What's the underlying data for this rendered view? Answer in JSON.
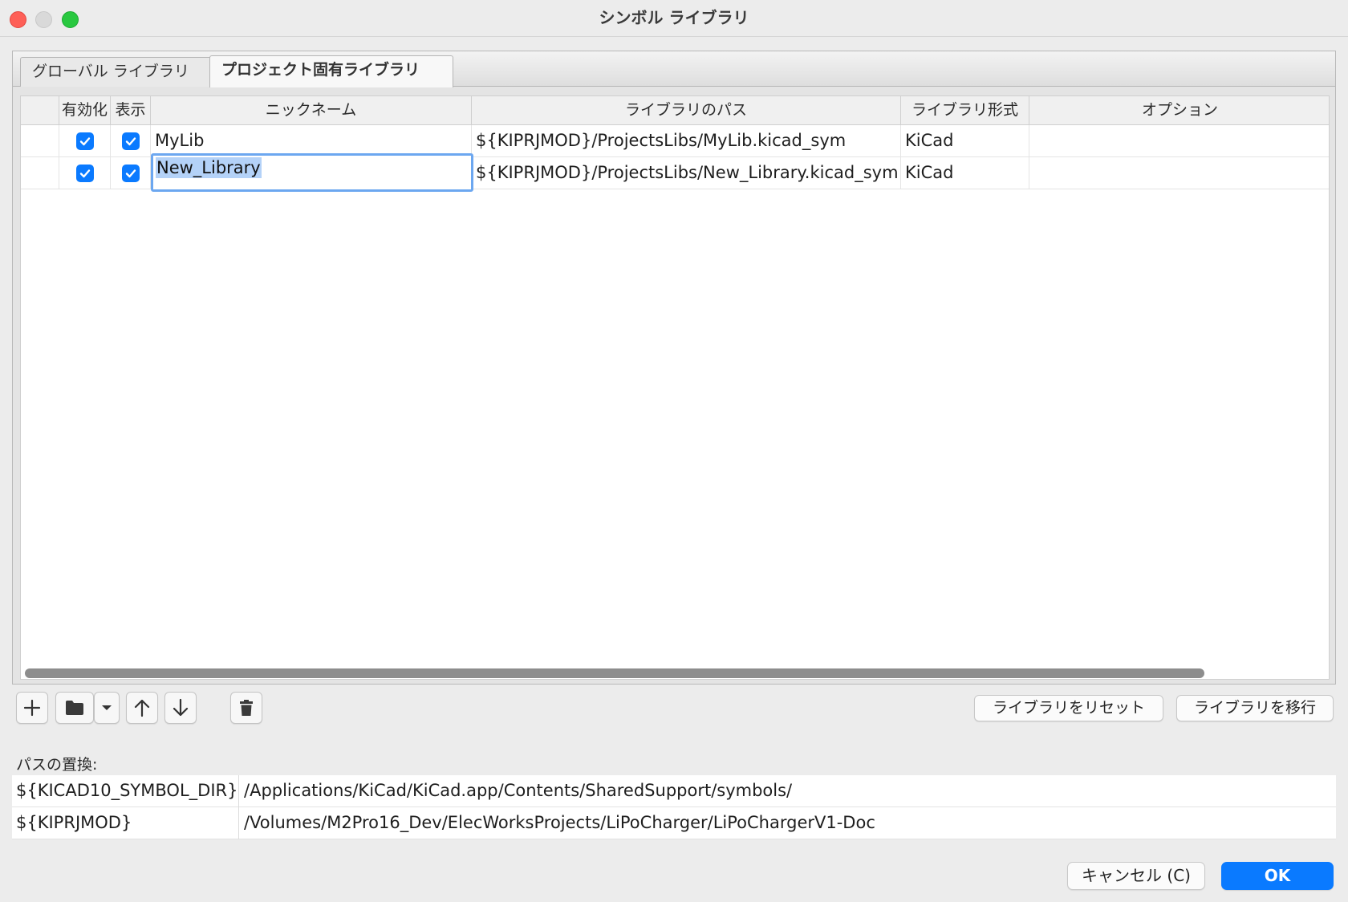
{
  "window": {
    "title": "シンボル ライブラリ"
  },
  "tabs": [
    {
      "label": "グローバル ライブラリ",
      "active": false
    },
    {
      "label": "プロジェクト固有ライブラリ",
      "active": true
    }
  ],
  "table": {
    "headers": {
      "enabled": "有効化",
      "visible": "表示",
      "nickname": "ニックネーム",
      "path": "ライブラリのパス",
      "format": "ライブラリ形式",
      "options": "オプション"
    },
    "rows": [
      {
        "enabled": true,
        "visible": true,
        "nickname": "MyLib",
        "path": "${KIPRJMOD}/ProjectsLibs/MyLib.kicad_sym",
        "format": "KiCad",
        "options": ""
      },
      {
        "enabled": true,
        "visible": true,
        "nickname": "New_Library",
        "path": "${KIPRJMOD}/ProjectsLibs/New_Library.kicad_sym",
        "format": "KiCad",
        "options": "",
        "editing": true
      }
    ]
  },
  "toolbar": {
    "icons": [
      "plus-icon",
      "folder-icon",
      "dropdown-icon",
      "arrow-up-icon",
      "arrow-down-icon",
      "trash-icon"
    ],
    "reset_label": "ライブラリをリセット",
    "migrate_label": "ライブラリを移行"
  },
  "substitutions": {
    "label": "パスの置換:",
    "items": [
      {
        "key": "${KICAD10_SYMBOL_DIR}",
        "value": "/Applications/KiCad/KiCad.app/Contents/SharedSupport/symbols/"
      },
      {
        "key": "${KIPRJMOD}",
        "value": "/Volumes/M2Pro16_Dev/ElecWorksProjects/LiPoCharger/LiPoChargerV1-Doc"
      }
    ]
  },
  "buttons": {
    "cancel": "キャンセル (C)",
    "ok": "OK"
  },
  "colors": {
    "accent": "#0a7aff",
    "selection": "#b4d2f8",
    "close": "#fe5f57",
    "maximize": "#29c840"
  }
}
